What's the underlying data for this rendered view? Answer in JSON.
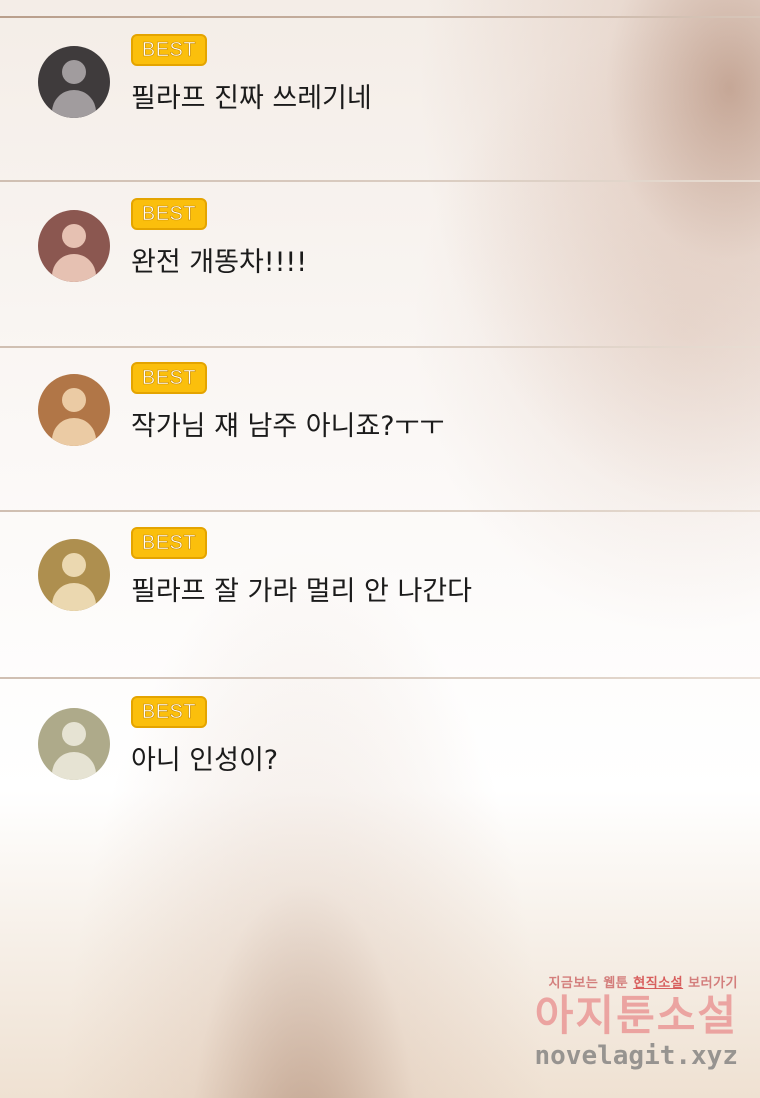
{
  "badge_label": "BEST",
  "comments": [
    {
      "text": "필라프 진짜 쓰레기네",
      "avatar_bg": "#3f3b3c",
      "avatar_fg": "#a19c9e"
    },
    {
      "text": "완전 개똥차!!!!",
      "avatar_bg": "#8b5750",
      "avatar_fg": "#e6c1b2"
    },
    {
      "text": "작가님 쟤 남주 아니죠?ㅜㅜ",
      "avatar_bg": "#b17647",
      "avatar_fg": "#ebcba4"
    },
    {
      "text": "필라프 잘 가라 멀리 안 나간다",
      "avatar_bg": "#ae8f4f",
      "avatar_fg": "#ebd8b0"
    },
    {
      "text": "아니 인성이?",
      "avatar_bg": "#aeaa8a",
      "avatar_fg": "#e6e3d3"
    }
  ],
  "watermark": {
    "tagline_prefix": "지금보는 웹툰",
    "tagline_highlight": "현직소설",
    "tagline_suffix": "보러가기",
    "title": "아지툰소설",
    "url": "novelagit.xyz"
  },
  "colors": {
    "badge_fill": "#fbbf0c",
    "badge_border": "#e4a400",
    "text": "#1b1b1b"
  }
}
